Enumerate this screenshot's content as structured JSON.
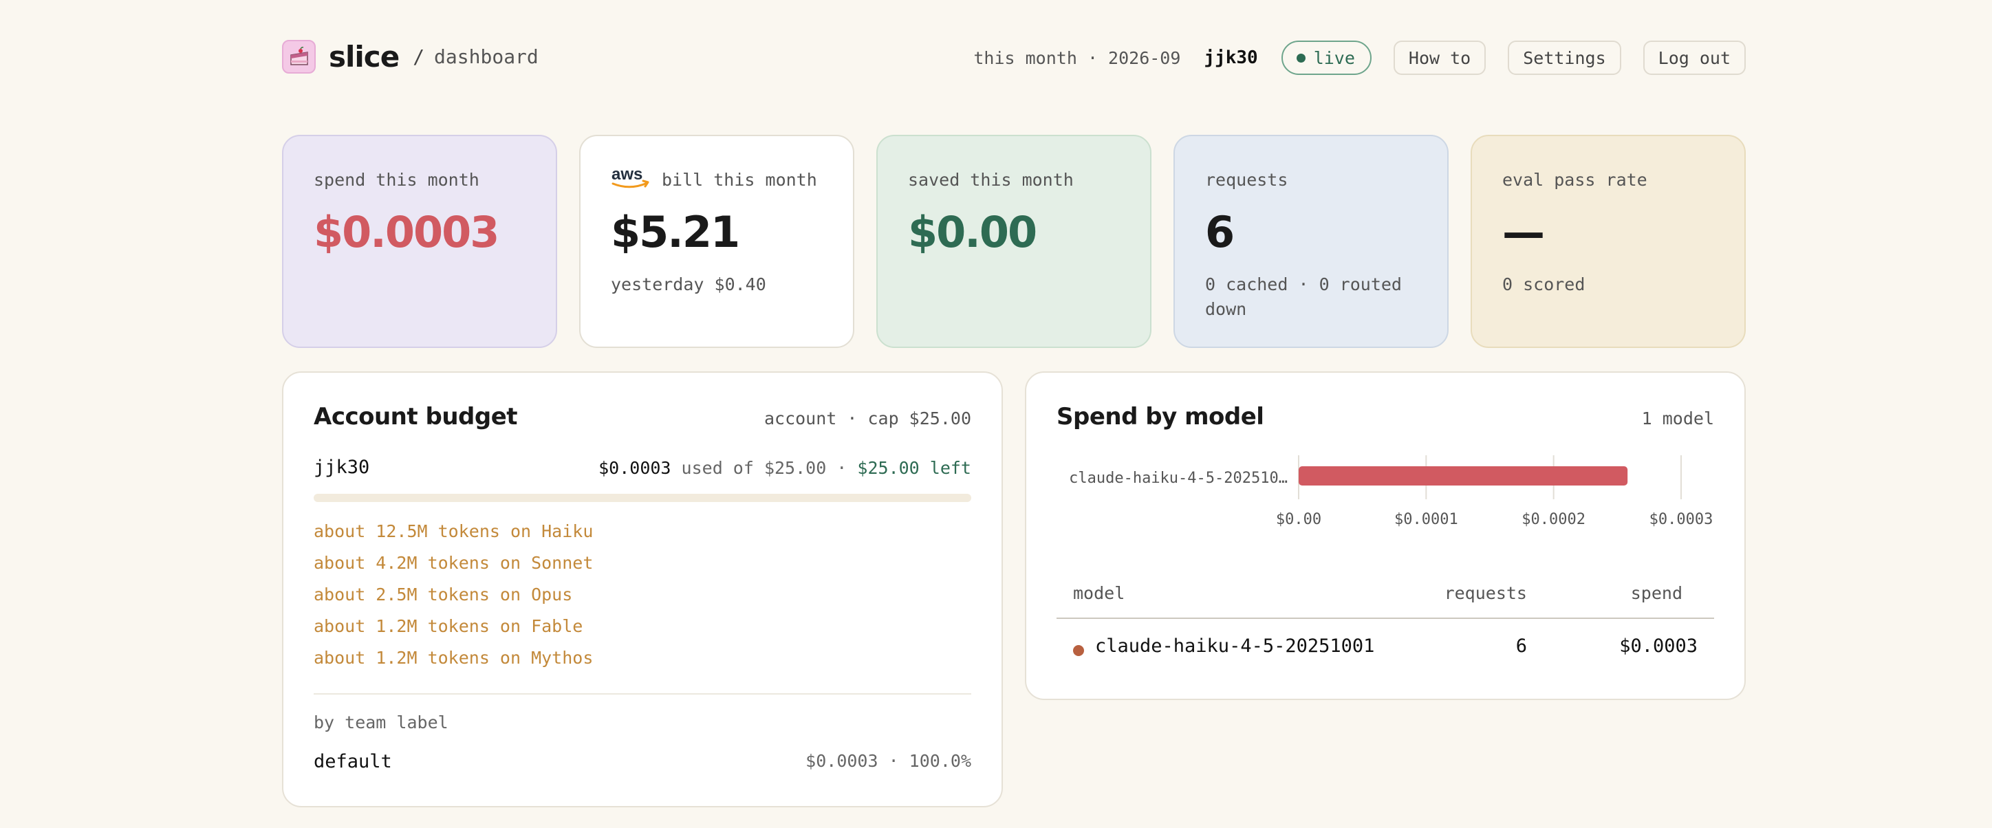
{
  "header": {
    "brand": "slice",
    "separator": "/",
    "page": "dashboard",
    "period": "this month · 2026-09",
    "user": "jjk30",
    "live_label": "live",
    "nav": [
      "How to",
      "Settings",
      "Log out"
    ]
  },
  "stats": {
    "spend": {
      "label": "spend this month",
      "value": "$0.0003"
    },
    "aws": {
      "label": "bill this month",
      "value": "$5.21",
      "sub": "yesterday $0.40",
      "logo_text": "aws"
    },
    "saved": {
      "label": "saved this month",
      "value": "$0.00"
    },
    "requests": {
      "label": "requests",
      "value": "6",
      "sub": "0 cached · 0 routed down"
    },
    "eval": {
      "label": "eval pass rate",
      "value": "—",
      "sub": "0 scored"
    }
  },
  "budget": {
    "title": "Account budget",
    "meta": "account · cap $25.00",
    "account": "jjk30",
    "used": "$0.0003",
    "used_of": " used of $25.00 · ",
    "left": "$25.00 left",
    "usage_fraction": 1.2e-05,
    "tokens": [
      "about 12.5M tokens on Haiku",
      "about 4.2M tokens on Sonnet",
      "about 2.5M tokens on Opus",
      "about 1.2M tokens on Fable",
      "about 1.2M tokens on Mythos"
    ],
    "team_label": "by team label",
    "team_name": "default",
    "team_value": "$0.0003 · 100.0%"
  },
  "spend_by_model": {
    "title": "Spend by model",
    "meta": "1 model",
    "table": {
      "headers": [
        "model",
        "requests",
        "spend"
      ],
      "rows": [
        {
          "model": "claude-haiku-4-5-20251001",
          "requests": "6",
          "spend": "$0.0003"
        }
      ]
    }
  },
  "chart_data": {
    "type": "bar",
    "orientation": "horizontal",
    "categories": [
      "claude-haiku-4-5-202510…"
    ],
    "values": [
      0.000258
    ],
    "xlim": [
      0,
      0.0003
    ],
    "ticks": [
      0,
      0.0001,
      0.0002,
      0.0003
    ],
    "tick_labels": [
      "$0.00",
      "$0.0001",
      "$0.0002",
      "$0.0003"
    ],
    "bar_color": "#d15a61",
    "grid": true
  },
  "colors": {
    "accent_red": "#d15a61",
    "accent_green": "#2e6b53",
    "token_text": "#c3893a",
    "model_dot": "#b8603f"
  }
}
